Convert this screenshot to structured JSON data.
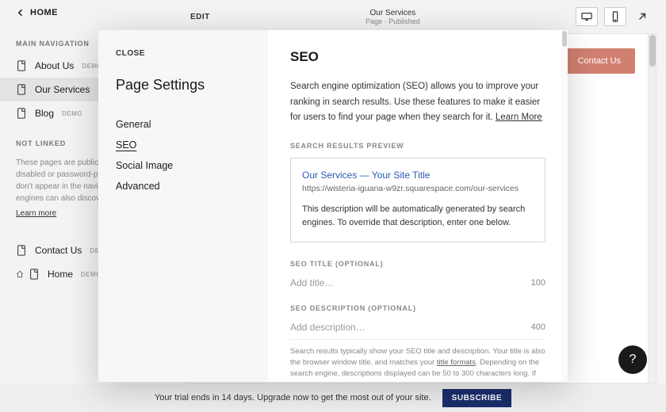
{
  "sidebar": {
    "home_label": "HOME",
    "main_nav_label": "MAIN NAVIGATION",
    "not_linked_label": "NOT LINKED",
    "items_main": [
      {
        "label": "About Us",
        "demo": "DEMO"
      },
      {
        "label": "Our Services",
        "demo": ""
      },
      {
        "label": "Blog",
        "demo": "DEMO"
      }
    ],
    "not_linked_desc": "These pages are public unless they're disabled or password-protected, but they don't appear in the navigation. Search engines can also discover them.",
    "learn_more": "Learn more",
    "items_notlinked": [
      {
        "label": "Contact Us",
        "demo": "DEMO"
      },
      {
        "label": "Home",
        "demo": "DEMO"
      }
    ]
  },
  "header": {
    "edit": "EDIT",
    "page_title": "Our Services",
    "page_sub": "Page · Published"
  },
  "preview": {
    "contact_btn": "Contact Us"
  },
  "trial": {
    "text": "Your trial ends in 14 days. Upgrade now to get the most out of your site.",
    "subscribe": "SUBSCRIBE"
  },
  "modal": {
    "close": "CLOSE",
    "title": "Page Settings",
    "tabs": [
      "General",
      "SEO",
      "Social Image",
      "Advanced"
    ],
    "active_tab": 1,
    "seo": {
      "heading": "SEO",
      "description": "Search engine optimization (SEO) allows you to improve your ranking in search results. Use these features to make it easier for users to find your page when they search for it. ",
      "learn_more": "Learn More",
      "preview_label": "SEARCH RESULTS PREVIEW",
      "preview_title": "Our Services — Your Site Title",
      "preview_url": "https://wisteria-iguana-w9zr.squarespace.com/our-services",
      "preview_desc": "This description will be automatically generated by search engines. To override that description, enter one below.",
      "title_label": "SEO TITLE (OPTIONAL)",
      "title_placeholder": "Add title…",
      "title_count": "100",
      "desc_label": "SEO DESCRIPTION (OPTIONAL)",
      "desc_placeholder": "Add description…",
      "desc_count": "400",
      "help_text_1": "Search results typically show your SEO title and description. Your title is also the browser window title, and matches your ",
      "help_link": "title formats",
      "help_text_2": ". Depending on the search engine, descriptions displayed can be 50 to 300 characters long. If you don't add a title or description, search engines will use your page title and content."
    }
  },
  "help_fab": "?"
}
